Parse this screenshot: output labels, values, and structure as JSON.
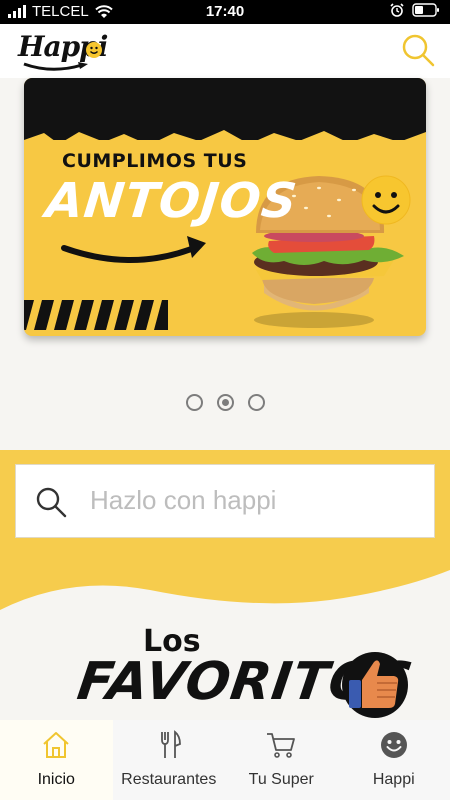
{
  "status_bar": {
    "carrier": "TELCEL",
    "time": "17:40",
    "icons": [
      "signal-bars-icon",
      "wifi-icon",
      "alarm-icon",
      "battery-icon"
    ]
  },
  "header": {
    "logo_text": "Happi",
    "search_icon": "search-icon"
  },
  "banner": {
    "line1": "CUMPLIMOS TUS",
    "line2": "ANTOJOS",
    "image": "burger-with-smiley"
  },
  "carousel": {
    "total_pages": 3,
    "active_index": 1
  },
  "search": {
    "placeholder": "Hazlo con happi"
  },
  "favorites": {
    "line1": "Los",
    "line2": "FAVORITOS"
  },
  "bottom_nav": {
    "items": [
      {
        "label": "Inicio",
        "icon": "home-icon",
        "active": true
      },
      {
        "label": "Restaurantes",
        "icon": "cutlery-icon",
        "active": false
      },
      {
        "label": "Tu Super",
        "icon": "shopping-cart-icon",
        "active": false
      },
      {
        "label": "Happi",
        "icon": "smiley-icon",
        "active": false
      }
    ]
  },
  "colors": {
    "brand_yellow": "#f6cc4d",
    "accent_yellow": "#f0c530",
    "dark": "#121212"
  }
}
